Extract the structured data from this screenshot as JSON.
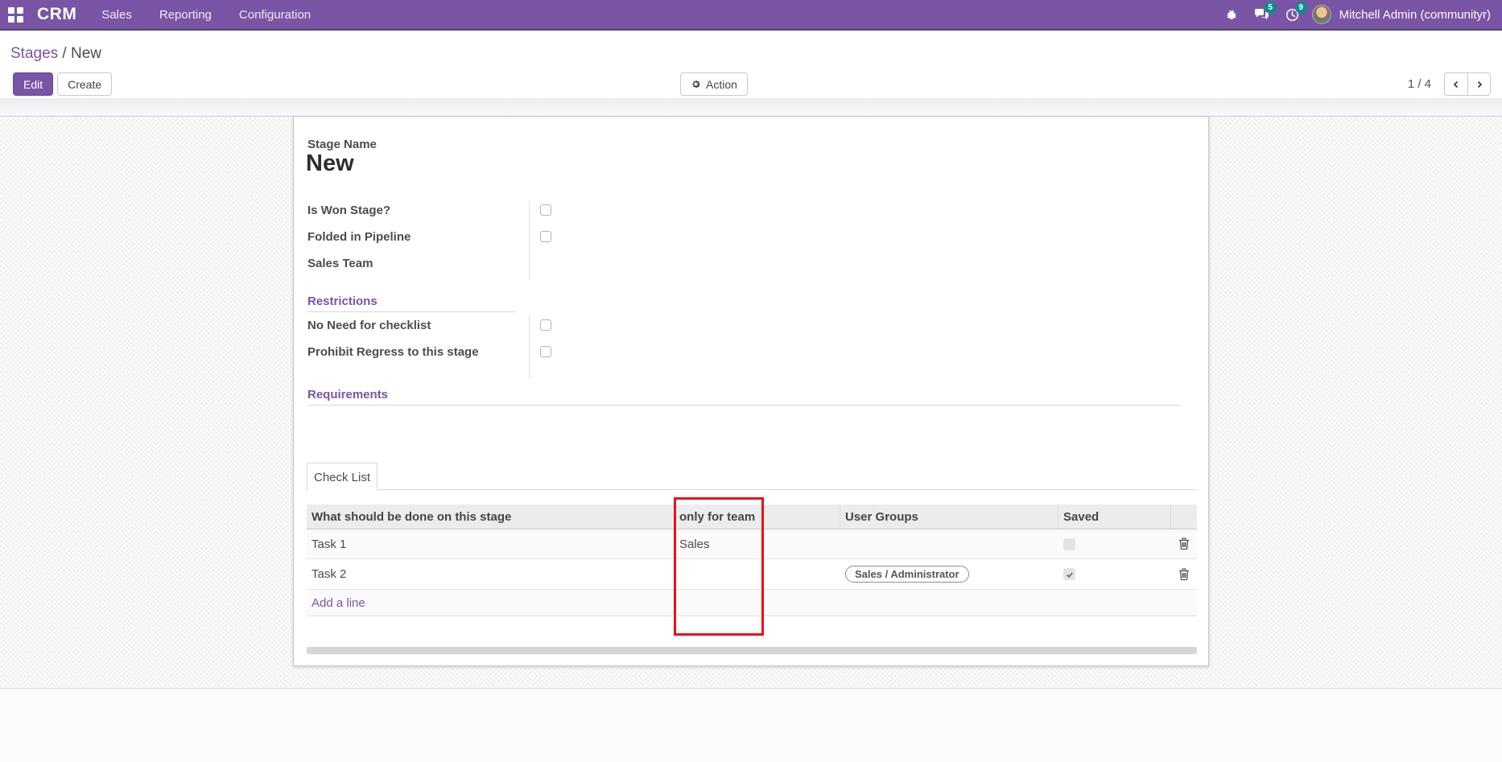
{
  "navbar": {
    "app_name": "CRM",
    "menu": [
      "Sales",
      "Reporting",
      "Configuration"
    ],
    "messages_badge": "5",
    "activities_badge": "9",
    "user_name": "Mitchell Admin (communityr)"
  },
  "breadcrumb": {
    "parent": "Stages",
    "separator": " / ",
    "current": "New"
  },
  "actions": {
    "edit": "Edit",
    "create": "Create",
    "action": "Action",
    "pager": "1 / 4"
  },
  "form": {
    "stage_name_label": "Stage Name",
    "stage_name": "New",
    "is_won_label": "Is Won Stage?",
    "folded_label": "Folded in Pipeline",
    "sales_team_label": "Sales Team",
    "is_won_checked": false,
    "folded_checked": false,
    "restrictions_title": "Restrictions",
    "no_checklist_label": "No Need for checklist",
    "prohibit_label": "Prohibit Regress to this stage",
    "no_checklist_checked": false,
    "prohibit_checked": false,
    "requirements_title": "Requirements",
    "tab_label": "Check List"
  },
  "table": {
    "headers": {
      "task": "What should be done on this stage",
      "team": "only for team",
      "groups": "User Groups",
      "saved": "Saved"
    },
    "rows": [
      {
        "task": "Task 1",
        "team": "Sales",
        "group": "",
        "saved": false
      },
      {
        "task": "Task 2",
        "team": "",
        "group": "Sales / Administrator",
        "saved": true
      }
    ],
    "add_line": "Add a line"
  },
  "icons": {
    "apps_grid": "▦",
    "bug": "🐞",
    "messages": "💬",
    "activities": "🕔",
    "gear": "⚙",
    "prev": "‹",
    "next": "›",
    "check": "✓",
    "trash": "🗑"
  },
  "colors": {
    "primary": "#7a54a5",
    "badge_teal": "#0d8e8e",
    "annotation_red": "#e8111c"
  }
}
